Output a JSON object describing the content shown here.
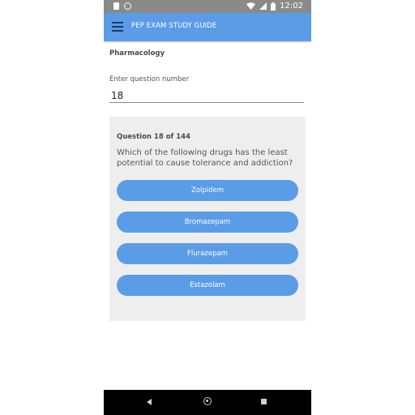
{
  "status_bar": {
    "time": "12:02",
    "icons": [
      "notification-doc-icon",
      "sync-icon",
      "wifi-icon",
      "signal-icon",
      "battery-icon"
    ]
  },
  "app_bar": {
    "title": "PEP EXAM STUDY GUIDE",
    "menu_icon": "hamburger-menu-icon"
  },
  "section": {
    "title": "Pharmacology"
  },
  "question_input": {
    "label": "Enter question number",
    "value": "18"
  },
  "quiz": {
    "counter": "Question 18 of 144",
    "question": "Which of the following drugs has the least potential to cause tolerance and addiction?",
    "answers": [
      {
        "label": "Zolpidem"
      },
      {
        "label": "Bromazepam"
      },
      {
        "label": "Flurazepam"
      },
      {
        "label": "Estazolam"
      }
    ]
  },
  "nav_bar": {
    "icons": [
      "back-icon",
      "home-icon",
      "recents-icon"
    ]
  },
  "colors": {
    "accent": "#5b9ce6",
    "status_bar": "#8a8a8a",
    "card_background": "#eeeeee",
    "nav_bar": "#000000"
  }
}
